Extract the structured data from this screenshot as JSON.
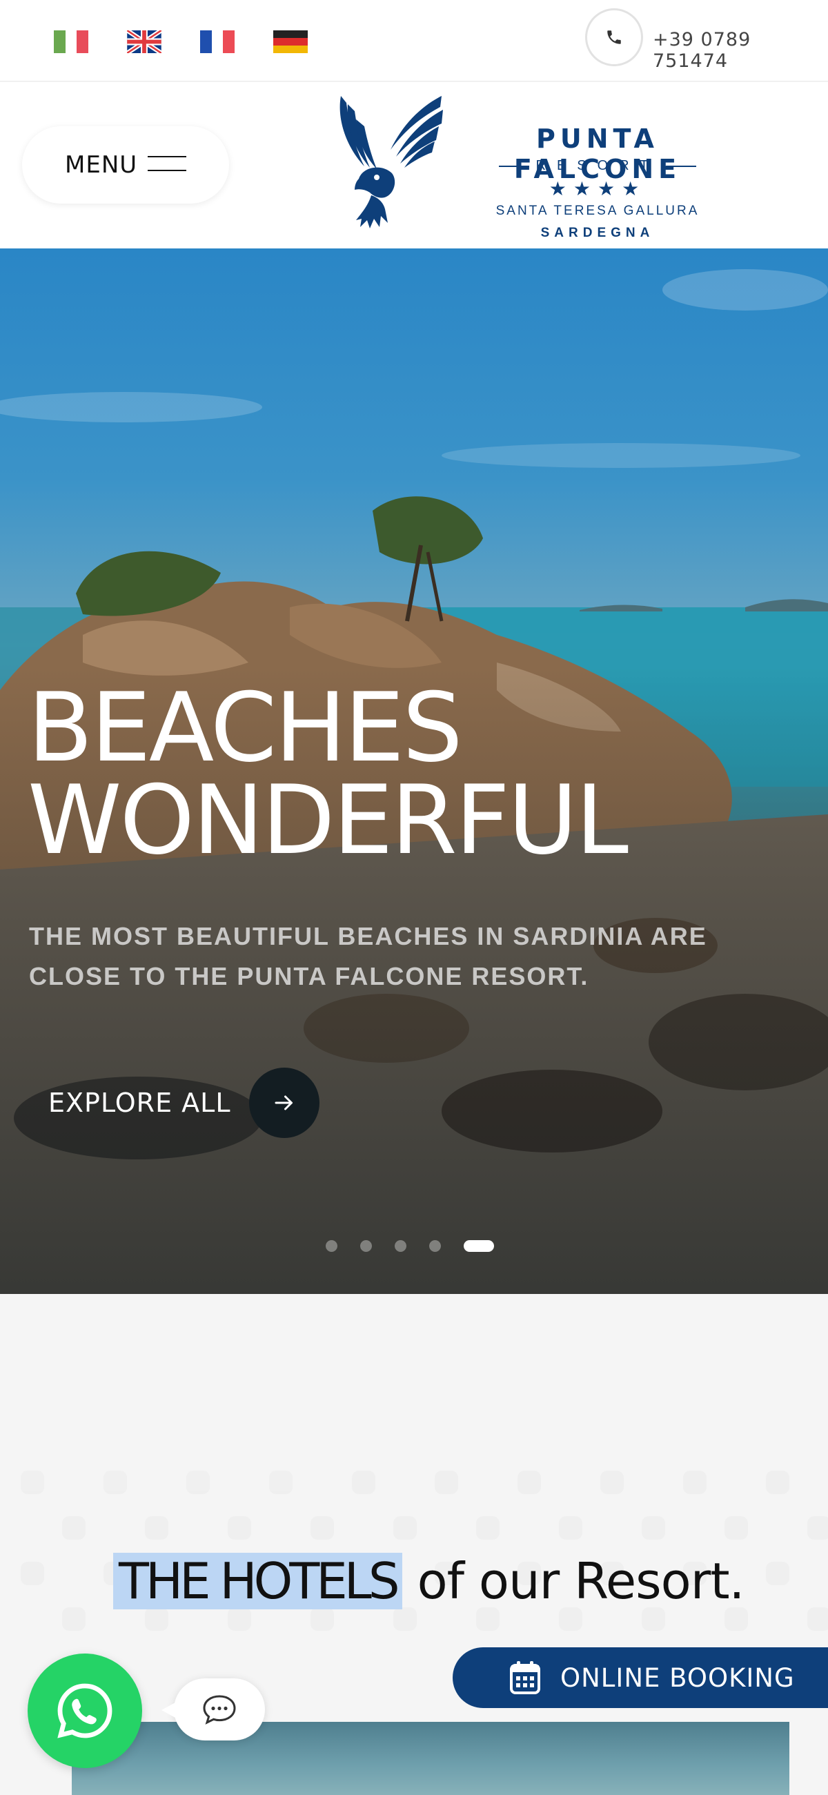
{
  "topbar": {
    "languages": [
      {
        "code": "it",
        "icon": "italy-flag-icon",
        "colors": [
          "#6aa84f",
          "#ffffff",
          "#e84c5a"
        ]
      },
      {
        "code": "en",
        "icon": "uk-flag-icon",
        "colors": [
          "#0c3a86",
          "#ffffff",
          "#e03a3e"
        ]
      },
      {
        "code": "fr",
        "icon": "france-flag-icon",
        "colors": [
          "#1f4fae",
          "#ffffff",
          "#ec4b55"
        ]
      },
      {
        "code": "de",
        "icon": "germany-flag-icon",
        "colors": [
          "#222222",
          "#dd2c2c",
          "#f2b705"
        ]
      }
    ],
    "phone_icon": "phone-icon",
    "phone": "+39 0789 751474"
  },
  "header": {
    "menu_label": "MENU",
    "logo": {
      "title": "PUNTA FALCONE",
      "resort": "RESORT",
      "stars": "★★★★",
      "place": "SANTA TERESA GALLURA",
      "region": "SARDEGNA",
      "color": "#0e3f7a"
    }
  },
  "hero": {
    "title": "BEACHES\nWONDERFUL",
    "subtitle": "THE MOST BEAUTIFUL BEACHES IN SARDINIA ARE CLOSE TO THE PUNTA FALCONE RESORT.",
    "cta_label": "EXPLORE ALL",
    "cta_icon": "arrow-right-icon",
    "slides_total": 5,
    "active_slide": 5
  },
  "hotels": {
    "title_highlight": "THE HOTELS",
    "title_rest": "of our Resort."
  },
  "floating": {
    "whatsapp_icon": "whatsapp-icon",
    "chat_icon": "chat-icon",
    "booking_icon": "calendar-icon",
    "booking_label": "ONLINE BOOKING",
    "accent": "#0e3f7a",
    "whatsapp_color": "#25d366"
  }
}
